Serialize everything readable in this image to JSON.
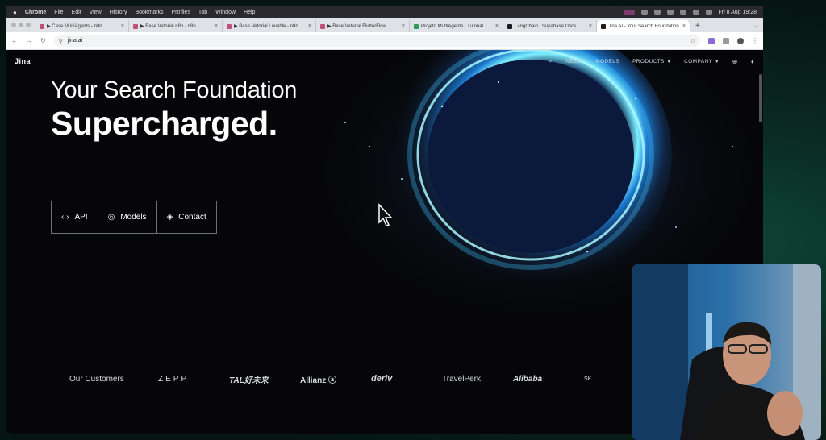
{
  "menubar": {
    "app": "Chrome",
    "items": [
      "File",
      "Edit",
      "View",
      "History",
      "Bookmarks",
      "Profiles",
      "Tab",
      "Window",
      "Help"
    ],
    "clock": "Fri 8 Aug  19:28"
  },
  "tabs": [
    {
      "title": "▶ Case MultiAgents - n8n",
      "icon": "n8n"
    },
    {
      "title": "▶ Base Vetorial n8n - n8n",
      "icon": "n8n"
    },
    {
      "title": "▶ Base Vetorial Lovable - n8n",
      "icon": "n8n"
    },
    {
      "title": "▶ Base Vetorial FlutterFlow",
      "icon": "n8n"
    },
    {
      "title": "Projeto MultiAgente | Tutorial",
      "icon": "green"
    },
    {
      "title": "LangChain | Supabase Docs",
      "icon": "dark"
    },
    {
      "title": "Jina AI - Your Search Foundation",
      "icon": "dark",
      "active": true
    }
  ],
  "address": {
    "url": "jina.ai"
  },
  "site": {
    "logo": "Jina",
    "nav": {
      "news": "NEWS",
      "models": "MODELS",
      "products": "PRODUCTS",
      "company": "COMPANY"
    },
    "hero_line1": "Your Search Foundation",
    "hero_line2": "Supercharged.",
    "cta": {
      "api": "API",
      "models": "Models",
      "contact": "Contact"
    },
    "customers_label": "Our Customers",
    "customers": [
      "ZEPP",
      "TAL好未来",
      "Allianz ⓐ",
      "deriv",
      "TravelPerk",
      "Alibaba",
      "SK"
    ]
  }
}
